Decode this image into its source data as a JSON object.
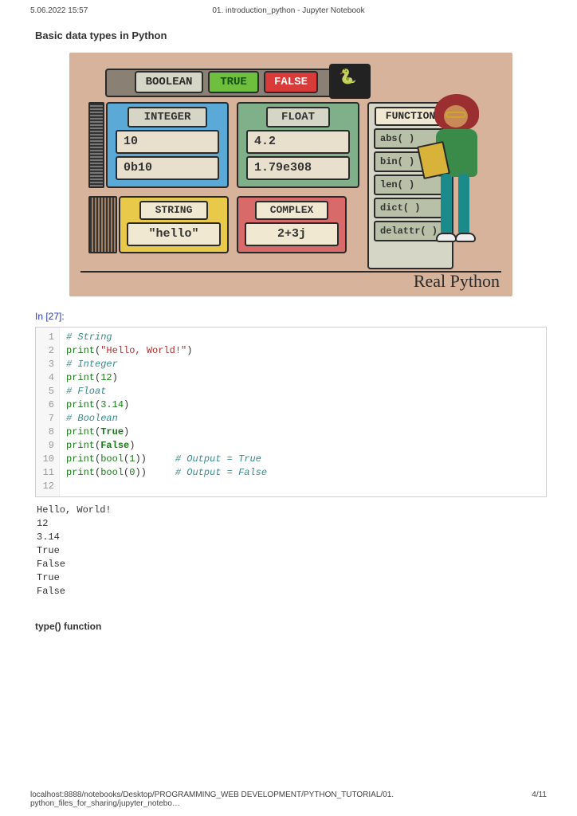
{
  "header": {
    "timestamp": "5.06.2022 15:57",
    "title": "01. introduction_python - Jupyter Notebook"
  },
  "section_title": "Basic data types in Python",
  "figure": {
    "boolean": {
      "label": "BOOLEAN",
      "true": "TRUE",
      "false": "FALSE"
    },
    "integer": {
      "label": "INTEGER",
      "v1": "10",
      "v2": "0b10"
    },
    "float": {
      "label": "FLOAT",
      "v1": "4.2",
      "v2": "1.79e308"
    },
    "string": {
      "label": "STRING",
      "v1": "\"hello\""
    },
    "complex": {
      "label": "COMPLEX",
      "v1": "2+3j"
    },
    "function": {
      "label": "FUNCTION",
      "items": [
        "abs( )",
        "bin( )",
        "len( )",
        "dict( )",
        "delattr( )"
      ]
    },
    "brand": "Real Python"
  },
  "cell": {
    "prompt": "In [27]:",
    "lines": [
      "1",
      "2",
      "3",
      "4",
      "5",
      "6",
      "7",
      "8",
      "9",
      "10",
      "11",
      "12"
    ],
    "code": {
      "l1": "# String",
      "l2a": "print",
      "l2b": "(",
      "l2c": "\"Hello, World!\"",
      "l2d": ")",
      "l3": "# Integer",
      "l4a": "print",
      "l4b": "(",
      "l4c": "12",
      "l4d": ")",
      "l5": "# Float",
      "l6a": "print",
      "l6b": "(",
      "l6c": "3.14",
      "l6d": ")",
      "l7": "# Boolean",
      "l8a": "print",
      "l8b": "(",
      "l8c": "True",
      "l8d": ")",
      "l9a": "print",
      "l9b": "(",
      "l9c": "False",
      "l9d": ")",
      "l10a": "print",
      "l10b": "(",
      "l10c": "bool",
      "l10d": "(",
      "l10e": "1",
      "l10f": "))",
      "l10g": "     # Output = True",
      "l11a": "print",
      "l11b": "(",
      "l11c": "bool",
      "l11d": "(",
      "l11e": "0",
      "l11f": "))",
      "l11g": "     # Output = False"
    },
    "output": "Hello, World!\n12\n3.14\nTrue\nFalse\nTrue\nFalse"
  },
  "subsection_title": "type() function",
  "footer": {
    "url": "localhost:8888/notebooks/Desktop/PROGRAMMING_WEB DEVELOPMENT/PYTHON_TUTORIAL/01. python_files_for_sharing/jupyter_notebo…",
    "page": "4/11"
  }
}
